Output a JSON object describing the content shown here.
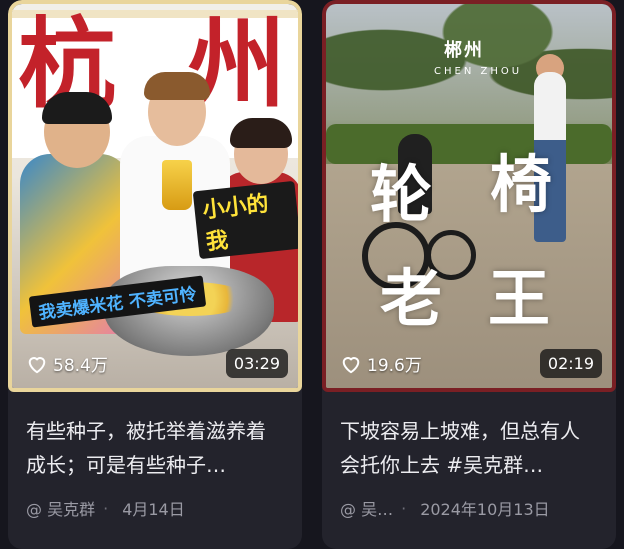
{
  "cards": [
    {
      "thumbnail": {
        "banner_text": [
          "杭",
          "州"
        ],
        "caption_small": "小小的我",
        "caption_popcorn": "我卖爆米花 不卖可怜"
      },
      "likes": "58.4万",
      "duration": "03:29",
      "description": "有些种子，被托举着滋养着成长；可是有些种子…",
      "author": "@ 吴克群",
      "date": "4月14日",
      "border_color": "#e9d59b"
    },
    {
      "thumbnail": {
        "city_name": "郴州",
        "city_pinyin": "CHEN ZHOU",
        "calligraphy": [
          "轮",
          "椅",
          "老",
          "王"
        ]
      },
      "likes": "19.6万",
      "duration": "02:19",
      "description": "下坡容易上坡难，但总有人会托你上去 #吴克群…",
      "author": "@ 吴…",
      "date": "2024年10月13日",
      "border_color": "#7a1f24"
    }
  ],
  "icons": {
    "like": "heart-outline-icon"
  }
}
